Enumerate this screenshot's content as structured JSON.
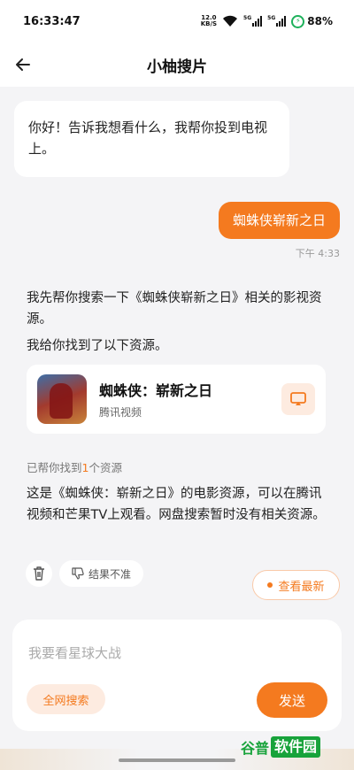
{
  "status_bar": {
    "time": "16:33:47",
    "net_speed_value": "12.0",
    "net_speed_unit": "KB/S",
    "sim1": "5G",
    "sim2": "5G",
    "battery": "88%",
    "battery_color": "#1eb15b"
  },
  "nav": {
    "title": "小柚搜片",
    "back_icon": "arrow-left-icon"
  },
  "chat": {
    "greeting": "你好！告诉我想看什么，我帮你投到电视上。",
    "user_message": "蜘蛛侠崭新之日",
    "user_time": "下午 4:33",
    "reply_line1": "我先帮你搜索一下《蜘蛛侠崭新之日》相关的影视资源。",
    "reply_line2": "我给你找到了以下资源。",
    "card": {
      "title": "蜘蛛侠：崭新之日",
      "source": "腾讯视频",
      "cast_icon": "cast-to-tv-icon"
    },
    "found_prefix": "已帮你找到",
    "found_count": "1",
    "found_suffix": "个资源",
    "description": "这是《蜘蛛侠：崭新之日》的电影资源，可以在腾讯视频和芒果TV上观看。网盘搜索暂时没有相关资源。",
    "inaccurate_label": "结果不准",
    "latest_label": "查看最新"
  },
  "input": {
    "placeholder": "我要看星球大战",
    "value": "",
    "web_search_label": "全网搜索",
    "send_label": "发送"
  },
  "watermark": {
    "part1": "谷普",
    "part2": "软件园"
  },
  "colors": {
    "accent": "#f47a1f",
    "accent_light": "#fdebe0",
    "background": "#f4f4f6"
  }
}
